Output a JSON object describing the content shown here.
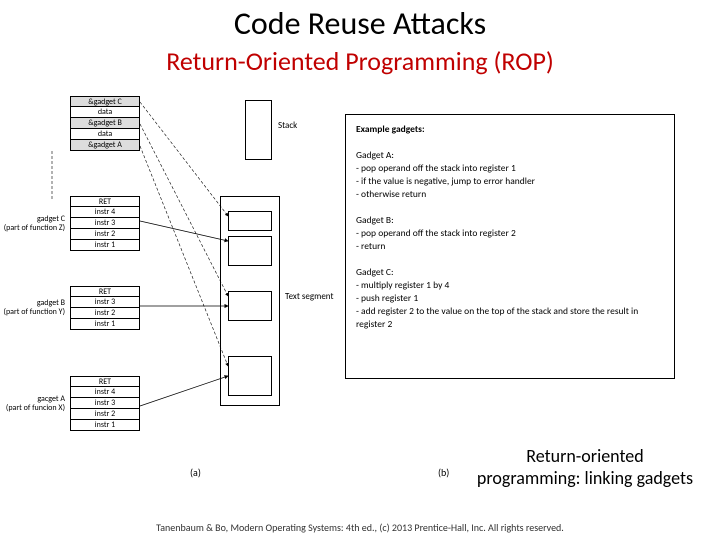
{
  "title": "Code Reuse Attacks",
  "subtitle": "Return-Oriented Programming (ROP)",
  "stack": {
    "cells": [
      "&gadget C",
      "data",
      "&gadget B",
      "data",
      "&gadget A"
    ],
    "label": "Stack"
  },
  "functions": [
    {
      "side": "gadget C\n(part of function Z)",
      "rows": [
        "RET",
        "instr 4",
        "instr 3",
        "instr 2",
        "instr 1"
      ]
    },
    {
      "side": "gadget B\n(part of function Y)",
      "rows": [
        "RET",
        "instr 3",
        "instr 2",
        "instr 1"
      ]
    },
    {
      "side": "gacget A\n(part of funcion X)",
      "rows": [
        "RET",
        "instr 4",
        "instr 3",
        "instr 2",
        "instr 1"
      ]
    }
  ],
  "text_segment_label": "Text segment",
  "example": {
    "heading": "Example gadgets:",
    "gadgets": [
      {
        "name": "Gadget A:",
        "lines": [
          "- pop operand off the stack into register 1",
          "- if the value is negative, jump to error handler",
          "- otherwise return"
        ]
      },
      {
        "name": "Gadget B:",
        "lines": [
          "- pop operand off the stack into register 2",
          "- return"
        ]
      },
      {
        "name": "Gadget C:",
        "lines": [
          "- multiply register 1 by 4",
          "- push register 1",
          "- add register 2 to the value on the top of the stack and store the result in register 2"
        ]
      }
    ]
  },
  "markers": {
    "a": "(a)",
    "b": "(b)"
  },
  "caption": "Return-oriented programming: linking gadgets",
  "footer": "Tanenbaum & Bo, Modern Operating Systems: 4th ed., (c) 2013 Prentice-Hall, Inc. All rights reserved."
}
